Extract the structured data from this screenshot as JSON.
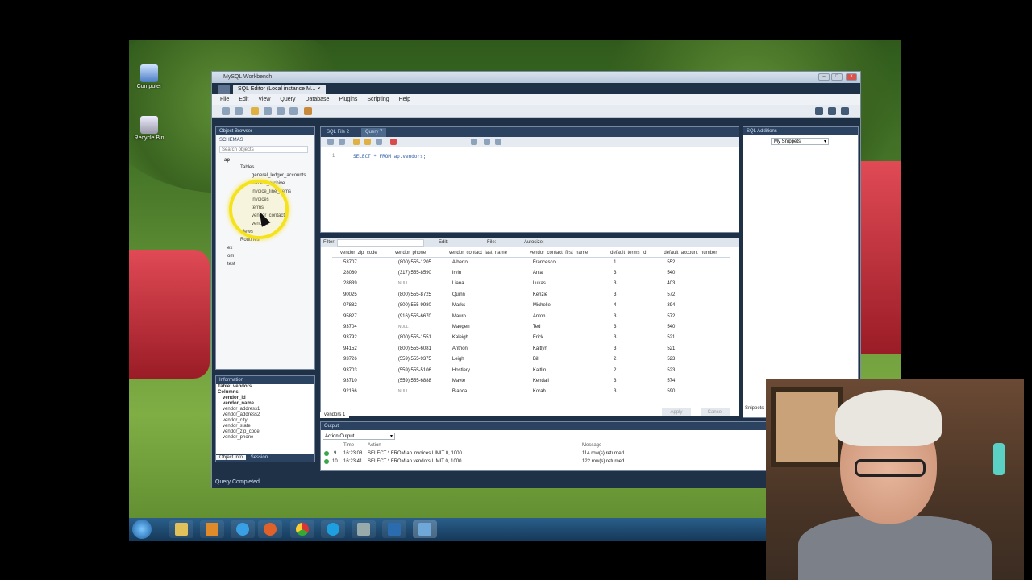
{
  "desktop": {
    "icons": [
      "Computer",
      "Recycle Bin"
    ]
  },
  "window": {
    "title": "MySQL Workbench",
    "tab_label": "SQL Editor (Local instance M...",
    "menu": [
      "File",
      "Edit",
      "View",
      "Query",
      "Database",
      "Plugins",
      "Scripting",
      "Help"
    ]
  },
  "object_browser": {
    "header": "Object Browser",
    "schemas_label": "SCHEMAS",
    "search_placeholder": "Search objects",
    "schema_ap": "ap",
    "tables_label": "Tables",
    "tables": [
      "general_ledger_accounts",
      "invoice_archive",
      "invoice_line_items",
      "invoices",
      "terms",
      "vendor_contacts",
      "vendors"
    ],
    "views_label": "Views",
    "routines_label": "Routines",
    "other_schemas": [
      "ex",
      "om",
      "test"
    ]
  },
  "info_panel": {
    "header": "Information",
    "table_line": "Table: vendors",
    "columns_label": "Columns:",
    "columns": [
      "vendor_id",
      "vendor_name",
      "vendor_address1",
      "vendor_address2",
      "vendor_city",
      "vendor_state",
      "vendor_zip_code",
      "vendor_phone"
    ],
    "tabs": [
      "Object Info",
      "Session"
    ]
  },
  "editor": {
    "tabs": [
      "SQL File 2",
      "Query 7"
    ],
    "line_number": "1",
    "sql": "SELECT * FROM ap.vendors;"
  },
  "results": {
    "filter_label": "Filter:",
    "edit_label": "Edit:",
    "file_label": "File:",
    "autosize_label": "Autosize:",
    "columns": [
      "vendor_zip_code",
      "vendor_phone",
      "vendor_contact_last_name",
      "vendor_contact_first_name",
      "default_terms_id",
      "default_account_number"
    ],
    "rows": [
      [
        "53707",
        "(800) 555-1205",
        "Alberto",
        "Francesco",
        "1",
        "552"
      ],
      [
        "28080",
        "(317) 555-8590",
        "Irvin",
        "Ania",
        "3",
        "540"
      ],
      [
        "28839",
        "NULL",
        "Liana",
        "Lukas",
        "3",
        "403"
      ],
      [
        "90025",
        "(800) 555-8725",
        "Quinn",
        "Kenzie",
        "3",
        "572"
      ],
      [
        "07882",
        "(800) 555-9980",
        "Marks",
        "Michelle",
        "4",
        "394"
      ],
      [
        "95827",
        "(916) 555-6670",
        "Mauro",
        "Anton",
        "3",
        "572"
      ],
      [
        "93704",
        "NULL",
        "Maegen",
        "Ted",
        "3",
        "540"
      ],
      [
        "93792",
        "(800) 555-1551",
        "Kaleigh",
        "Erick",
        "3",
        "521"
      ],
      [
        "94152",
        "(800) 555-6081",
        "Anthoni",
        "Kaitlyn",
        "3",
        "521"
      ],
      [
        "93726",
        "(559) 555-9375",
        "Leigh",
        "Bill",
        "2",
        "523"
      ],
      [
        "93703",
        "(559) 555-5106",
        "Hostlery",
        "Kaitlin",
        "2",
        "523"
      ],
      [
        "93710",
        "(559) 555-6888",
        "Mayte",
        "Kendall",
        "3",
        "574"
      ],
      [
        "92166",
        "NULL",
        "Blanca",
        "Korah",
        "3",
        "590"
      ]
    ],
    "result_tab": "vendors 1",
    "apply_label": "Apply",
    "cancel_label": "Cancel"
  },
  "additions": {
    "header": "SQL Additions",
    "snippets_select": "My Snippets",
    "side_tab": "Snippets"
  },
  "output": {
    "header": "Output",
    "select_value": "Action Output",
    "columns": [
      "Time",
      "Action",
      "Message"
    ],
    "rows": [
      {
        "num": "9",
        "time": "16:23:08",
        "action": "SELECT * FROM ap.invoices LIMIT 0, 1000",
        "message": "114 row(s) returned"
      },
      {
        "num": "10",
        "time": "16:23:41",
        "action": "SELECT * FROM ap.vendors LIMIT 0, 1000",
        "message": "122 row(s) returned"
      }
    ]
  },
  "status_text": "Query Completed",
  "colors": {
    "chrome": "#1f3147",
    "accent": "#2c5ea8",
    "highlight_ring": "#f5e21a"
  }
}
